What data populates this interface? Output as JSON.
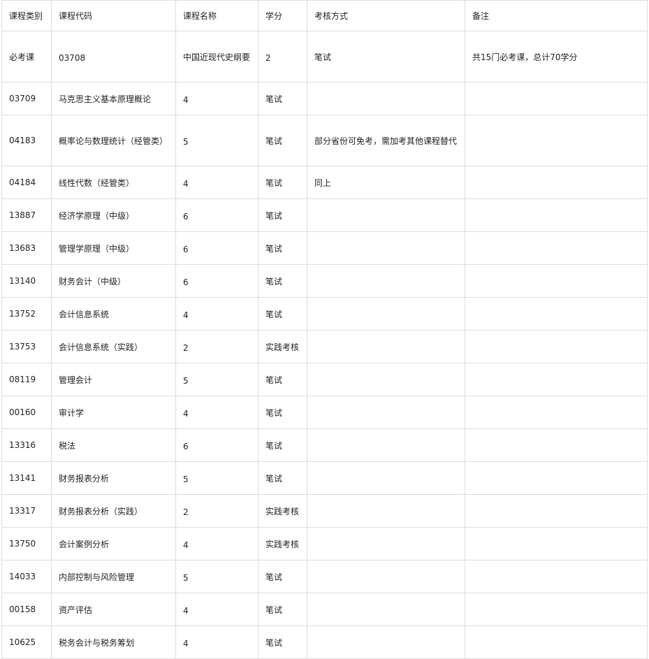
{
  "headers": [
    "课程类别",
    "课程代码",
    "课程名称",
    "学分",
    "考核方式",
    "备注"
  ],
  "rows": [
    {
      "category": "必考课",
      "code": "03708",
      "name": "中国近现代史纲要",
      "credit": "2",
      "exam": "笔试",
      "note": "共15门必考课，总计70学分"
    },
    {
      "category": "03709",
      "code": "马克思主义基本原理概论",
      "name": "4",
      "credit": "笔试",
      "exam": "",
      "note": ""
    },
    {
      "category": "04183",
      "code": "概率论与数理统计（经管类）",
      "name": "5",
      "credit": "笔试",
      "exam": "部分省份可免考，需加考其他课程替代",
      "note": ""
    },
    {
      "category": "04184",
      "code": "线性代数（经管类）",
      "name": "4",
      "credit": "笔试",
      "exam": "同上",
      "note": ""
    },
    {
      "category": "13887",
      "code": "经济学原理（中级）",
      "name": "6",
      "credit": "笔试",
      "exam": "",
      "note": ""
    },
    {
      "category": "13683",
      "code": "管理学原理（中级）",
      "name": "6",
      "credit": "笔试",
      "exam": "",
      "note": ""
    },
    {
      "category": "13140",
      "code": "财务会计（中级）",
      "name": "6",
      "credit": "笔试",
      "exam": "",
      "note": ""
    },
    {
      "category": "13752",
      "code": "会计信息系统",
      "name": "4",
      "credit": "笔试",
      "exam": "",
      "note": ""
    },
    {
      "category": "13753",
      "code": "会计信息系统（实践）",
      "name": "2",
      "credit": "实践考核",
      "exam": "",
      "note": ""
    },
    {
      "category": "08119",
      "code": "管理会计",
      "name": "5",
      "credit": "笔试",
      "exam": "",
      "note": ""
    },
    {
      "category": "00160",
      "code": "审计学",
      "name": "4",
      "credit": "笔试",
      "exam": "",
      "note": ""
    },
    {
      "category": "13316",
      "code": "税法",
      "name": "6",
      "credit": "笔试",
      "exam": "",
      "note": ""
    },
    {
      "category": "13141",
      "code": "财务报表分析",
      "name": "5",
      "credit": "笔试",
      "exam": "",
      "note": ""
    },
    {
      "category": "13317",
      "code": "财务报表分析（实践）",
      "name": "2",
      "credit": "实践考核",
      "exam": "",
      "note": ""
    },
    {
      "category": "13750",
      "code": "会计案例分析",
      "name": "4",
      "credit": "实践考核",
      "exam": "",
      "note": ""
    },
    {
      "category": "14033",
      "code": "内部控制与风险管理",
      "name": "5",
      "credit": "笔试",
      "exam": "",
      "note": ""
    },
    {
      "category": "00158",
      "code": "资产评估",
      "name": "4",
      "credit": "笔试",
      "exam": "",
      "note": ""
    },
    {
      "category": "10625",
      "code": "税务会计与税务筹划",
      "name": "4",
      "credit": "笔试",
      "exam": "",
      "note": ""
    }
  ]
}
